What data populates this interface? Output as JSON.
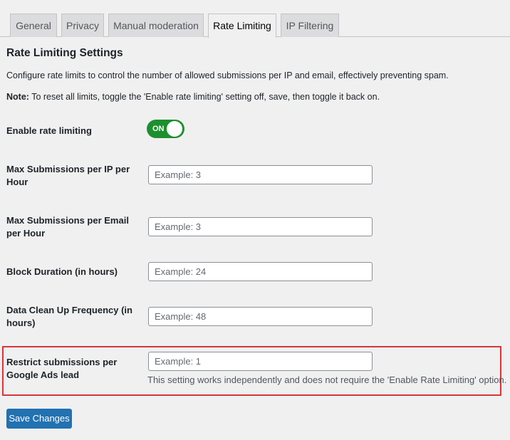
{
  "tabs": [
    {
      "label": "General"
    },
    {
      "label": "Privacy"
    },
    {
      "label": "Manual moderation"
    },
    {
      "label": "Rate Limiting",
      "active": true
    },
    {
      "label": "IP Filtering"
    }
  ],
  "section": {
    "title": "Rate Limiting Settings",
    "description": "Configure rate limits to control the number of allowed submissions per IP and email, effectively preventing spam.",
    "note_prefix": "Note:",
    "note_text": " To reset all limits, toggle the 'Enable rate limiting' setting off, save, then toggle it back on."
  },
  "settings": {
    "enable_rate_limiting": {
      "label": "Enable rate limiting",
      "toggle_text": "ON",
      "enabled": true
    },
    "max_per_ip": {
      "label": "Max Submissions per IP per Hour",
      "placeholder": "Example: 3",
      "value": ""
    },
    "max_per_email": {
      "label": "Max Submissions per Email per Hour",
      "placeholder": "Example: 3",
      "value": ""
    },
    "block_duration": {
      "label": "Block Duration (in hours)",
      "placeholder": "Example: 24",
      "value": ""
    },
    "cleanup_frequency": {
      "label": "Data Clean Up Frequency (in hours)",
      "placeholder": "Example: 48",
      "value": ""
    },
    "google_ads": {
      "label": "Restrict submissions per Google Ads lead",
      "placeholder": "Example: 1",
      "value": "",
      "help": "This setting works independently and does not require the 'Enable Rate Limiting' option."
    }
  },
  "save_button": {
    "label": "Save Changes"
  },
  "colors": {
    "accent": "#2271b1",
    "toggle_on": "#1e8f2e",
    "highlight_border": "#d63638"
  }
}
